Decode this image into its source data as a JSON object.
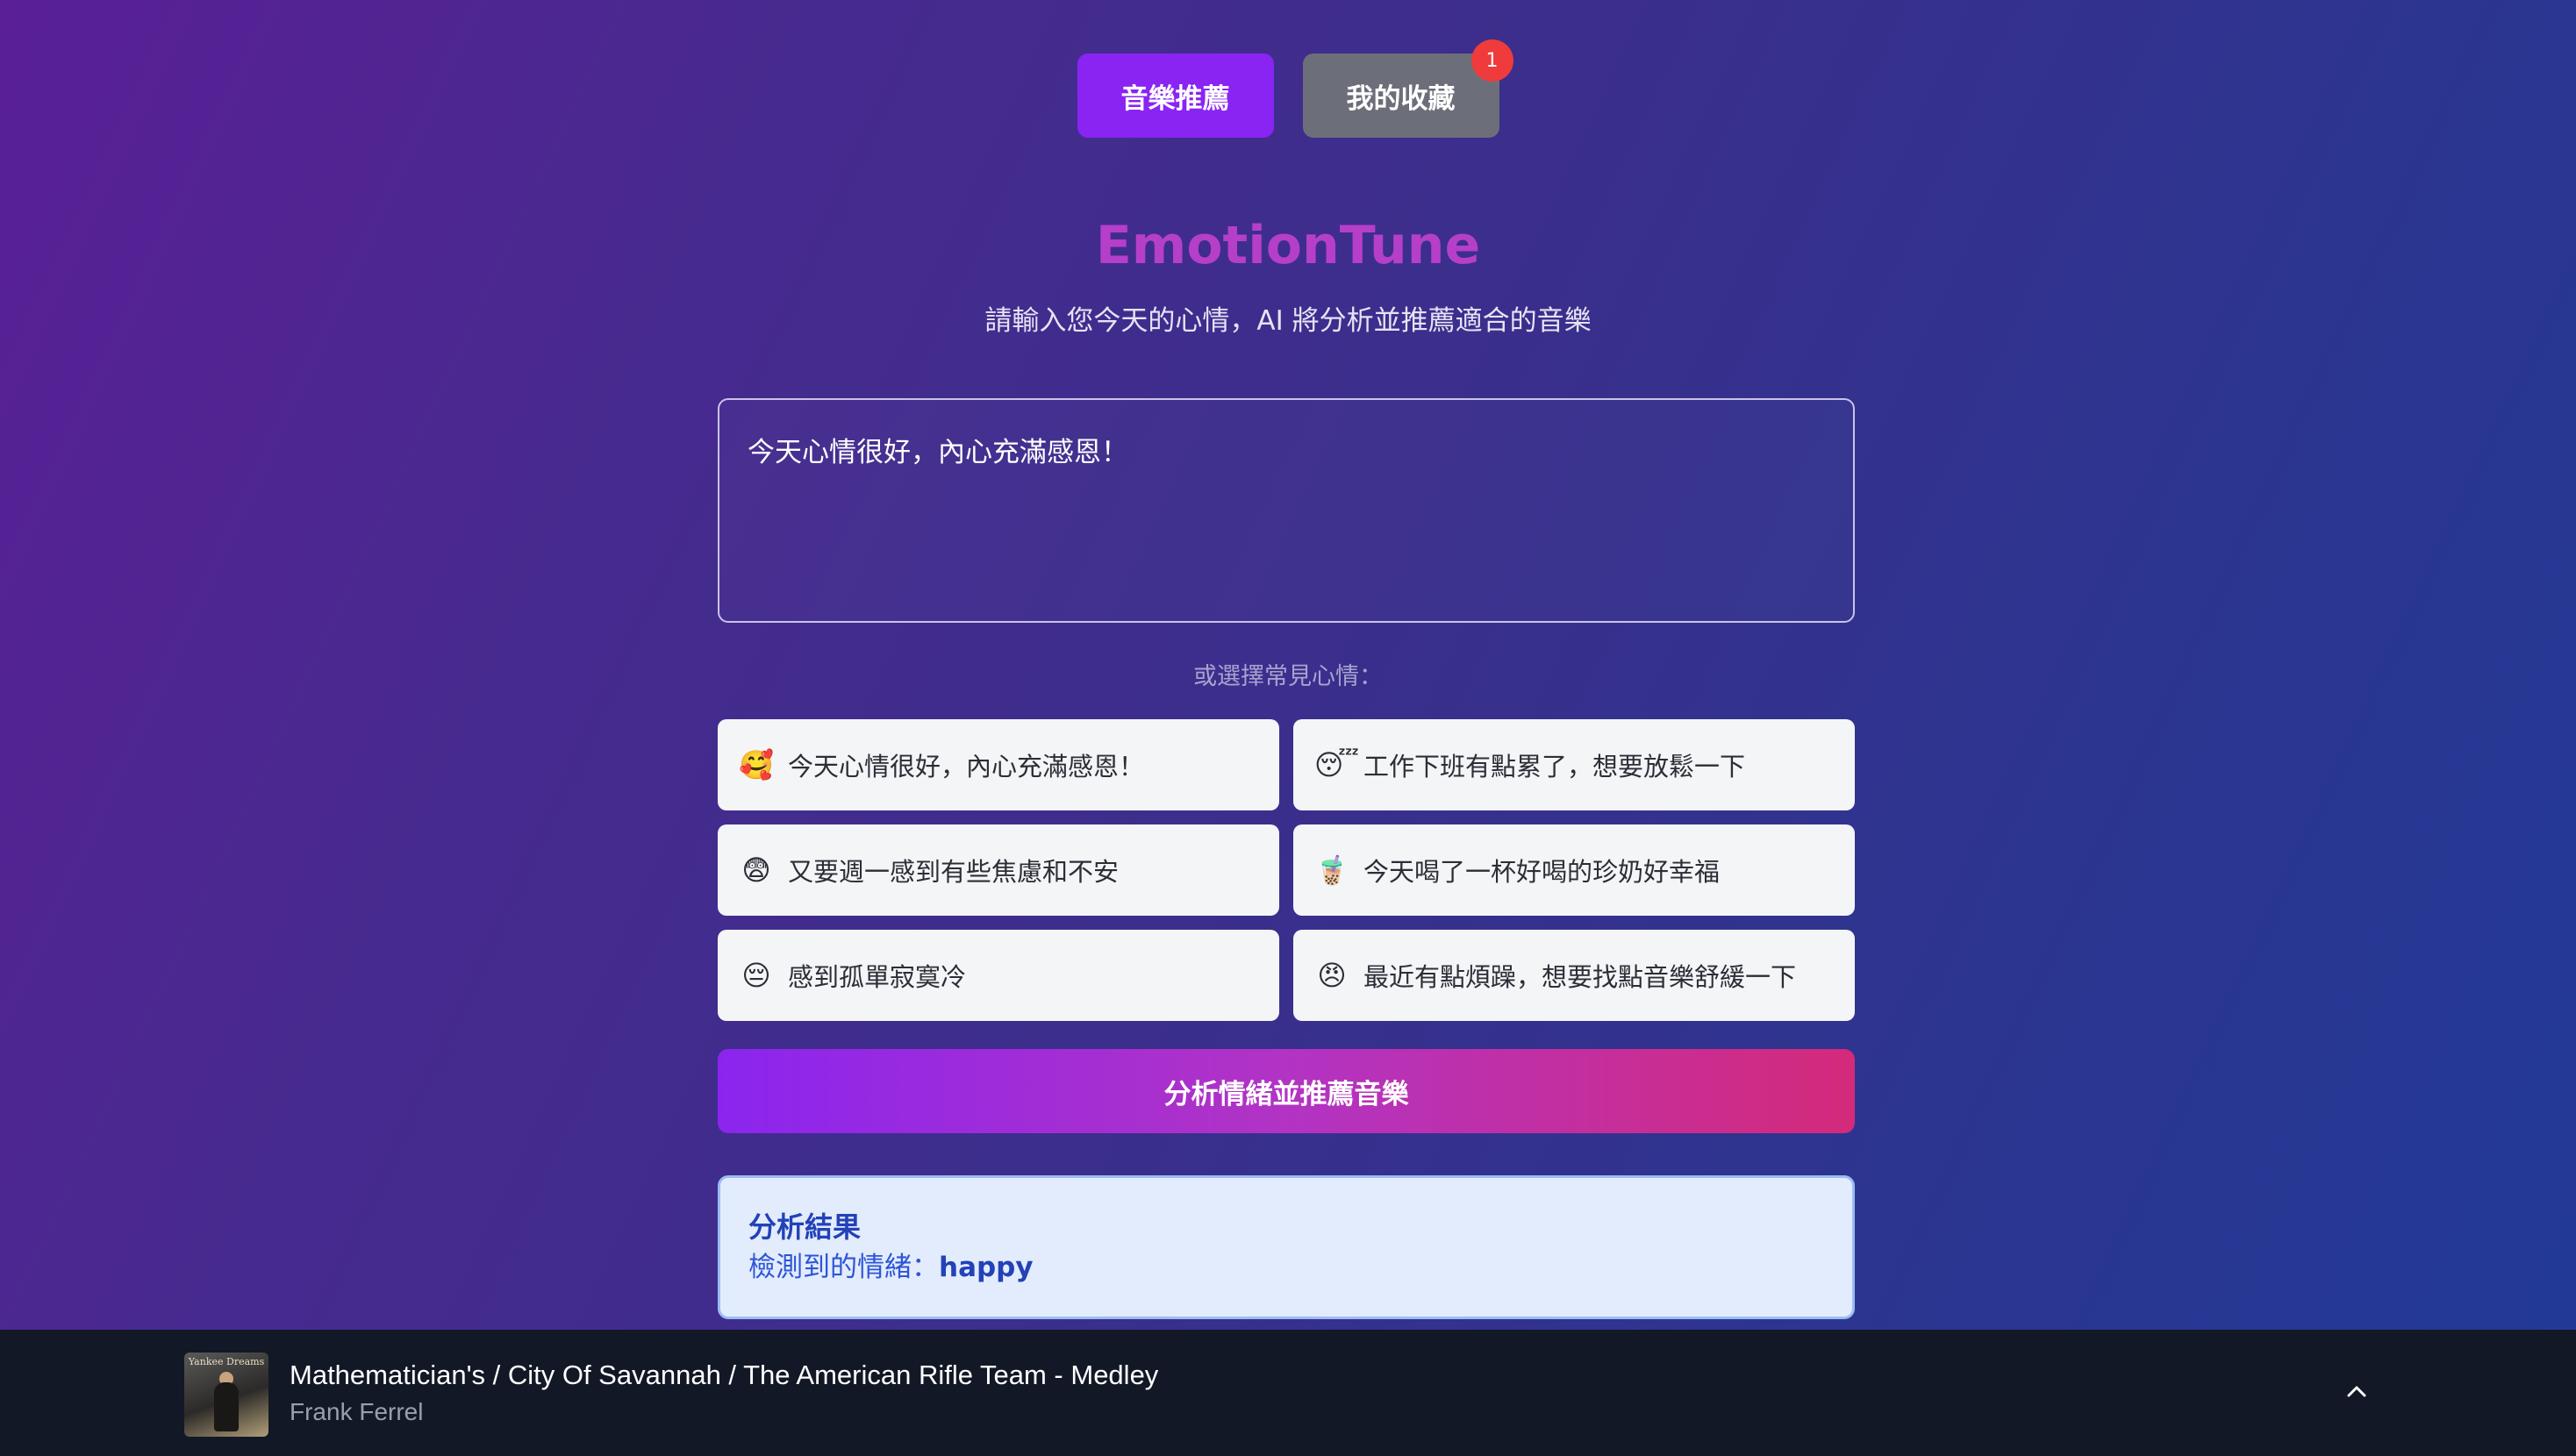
{
  "nav": {
    "recommend_label": "音樂推薦",
    "favorites_label": "我的收藏",
    "favorites_count": "1"
  },
  "header": {
    "title": "EmotionTune",
    "subtitle": "請輸入您今天的心情，AI 將分析並推薦適合的音樂"
  },
  "mood_input": {
    "value": "今天心情很好，內心充滿感恩！"
  },
  "presets": {
    "label": "或選擇常見心情：",
    "items": [
      {
        "emoji": "🥰",
        "text": "今天心情很好，內心充滿感恩！"
      },
      {
        "emoji": "😴",
        "text": "工作下班有點累了，想要放鬆一下"
      },
      {
        "emoji": "😨",
        "text": "又要週一感到有些焦慮和不安"
      },
      {
        "emoji": "🧋",
        "text": "今天喝了一杯好喝的珍奶好幸福"
      },
      {
        "emoji": "😔",
        "text": "感到孤單寂寞冷"
      },
      {
        "emoji": "😠",
        "text": "最近有點煩躁，想要找點音樂舒緩一下"
      }
    ]
  },
  "analyze_button": {
    "label": "分析情緒並推薦音樂"
  },
  "result": {
    "title": "分析結果",
    "emotion_prefix": "檢測到的情緒：",
    "emotion": "happy"
  },
  "player": {
    "album_text": "Yankee Dreams",
    "track_title": "Mathematician's / City Of Savannah / The American Rifle Team - Medley",
    "artist": "Frank Ferrel",
    "expand_icon": "chevron-up-icon"
  }
}
